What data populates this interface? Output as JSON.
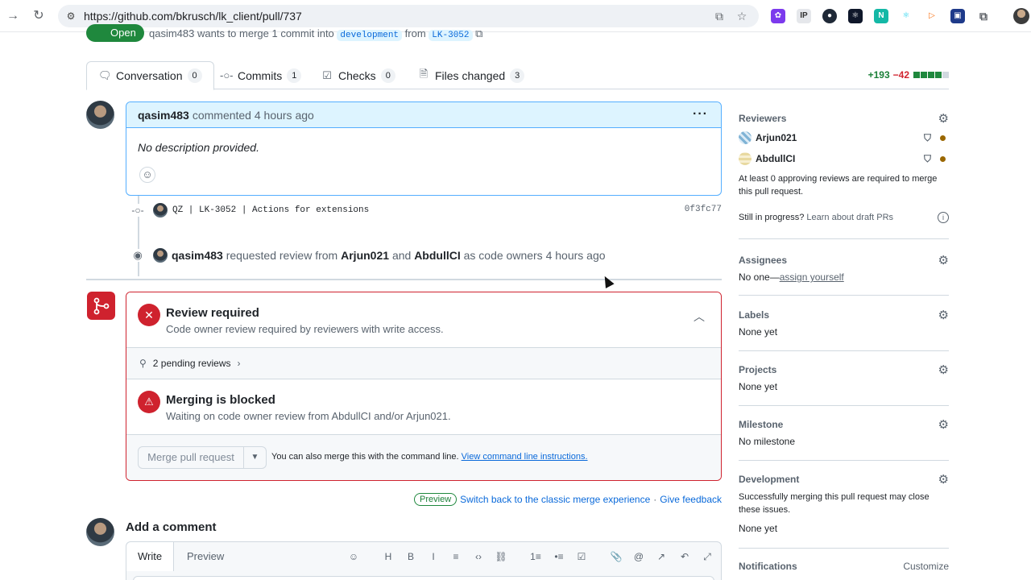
{
  "browser": {
    "url": "https://github.com/bkrusch/lk_client/pull/737",
    "extension_labels": [
      "IP",
      "N"
    ]
  },
  "pr": {
    "state": "Open",
    "author": "qasim483",
    "meta_text": "wants to merge 1 commit into",
    "base_branch": "development",
    "from_text": "from",
    "head_branch": "LK-3052"
  },
  "tabs": [
    {
      "label": "Conversation",
      "count": "0",
      "icon": "comment-icon"
    },
    {
      "label": "Commits",
      "count": "1",
      "icon": "commit-icon"
    },
    {
      "label": "Checks",
      "count": "0",
      "icon": "checklist-icon"
    },
    {
      "label": "Files changed",
      "count": "3",
      "icon": "file-diff-icon"
    }
  ],
  "diffstat": {
    "additions": "+193",
    "deletions": "−42",
    "squares_green": 4,
    "squares_grey": 1
  },
  "comment": {
    "author": "qasim483",
    "action": "commented 4 hours ago",
    "body": "No description provided."
  },
  "commit": {
    "message": "QZ | LK-3052 | Actions for extensions",
    "sha": "0f3fc77"
  },
  "review_request": {
    "actor": "qasim483",
    "text1": "requested review from",
    "reviewer1": "Arjun021",
    "and": "and",
    "reviewer2": "AbdullCI",
    "text2": "as code owners 4 hours ago"
  },
  "merge_box": {
    "review_title": "Review required",
    "review_sub": "Code owner review required by reviewers with write access.",
    "pending": "2 pending reviews",
    "blocked_title": "Merging is blocked",
    "blocked_sub": "Waiting on code owner review from AbdullCI and/or Arjun021.",
    "merge_button": "Merge pull request",
    "hint_text": "You can also merge this with the command line.",
    "hint_link": "View command line instructions."
  },
  "preview_row": {
    "badge": "Preview",
    "switch_link": "Switch back to the classic merge experience",
    "sep": "·",
    "feedback_link": "Give feedback"
  },
  "add_comment": {
    "title": "Add a comment",
    "tab_write": "Write",
    "tab_preview": "Preview",
    "toolbar": [
      "copilot-icon",
      "heading-icon",
      "bold-icon",
      "italic-icon",
      "quote-icon",
      "code-icon",
      "link-icon",
      "ordered-list-icon",
      "unordered-list-icon",
      "task-list-icon",
      "attach-icon",
      "mention-icon",
      "reference-icon",
      "undo-icon",
      "fullscreen-icon"
    ],
    "toolbar_glyphs": [
      "☺",
      "H",
      "B",
      "I",
      "≡",
      "‹›",
      "⛓",
      "1≡",
      "•≡",
      "☑",
      "📎",
      "@",
      "↗",
      "↶",
      "⤢"
    ]
  },
  "sidebar": {
    "reviewers_title": "Reviewers",
    "reviewers": [
      {
        "name": "Arjun021"
      },
      {
        "name": "AbdullCI"
      }
    ],
    "approval_note": "At least 0 approving reviews are required to merge this pull request.",
    "draft_text": "Still in progress?",
    "draft_link": "Learn about draft PRs",
    "assignees_title": "Assignees",
    "assignees_value": "No one—",
    "assign_link": "assign yourself",
    "labels_title": "Labels",
    "labels_value": "None yet",
    "projects_title": "Projects",
    "projects_value": "None yet",
    "milestone_title": "Milestone",
    "milestone_value": "No milestone",
    "development_title": "Development",
    "development_note": "Successfully merging this pull request may close these issues.",
    "development_value": "None yet",
    "notifications_title": "Notifications",
    "customize": "Customize"
  },
  "colors": {
    "open_green": "#1f883d",
    "blocked_red": "#cf222e",
    "link_blue": "#0969da",
    "comment_header": "#ddf4ff"
  }
}
